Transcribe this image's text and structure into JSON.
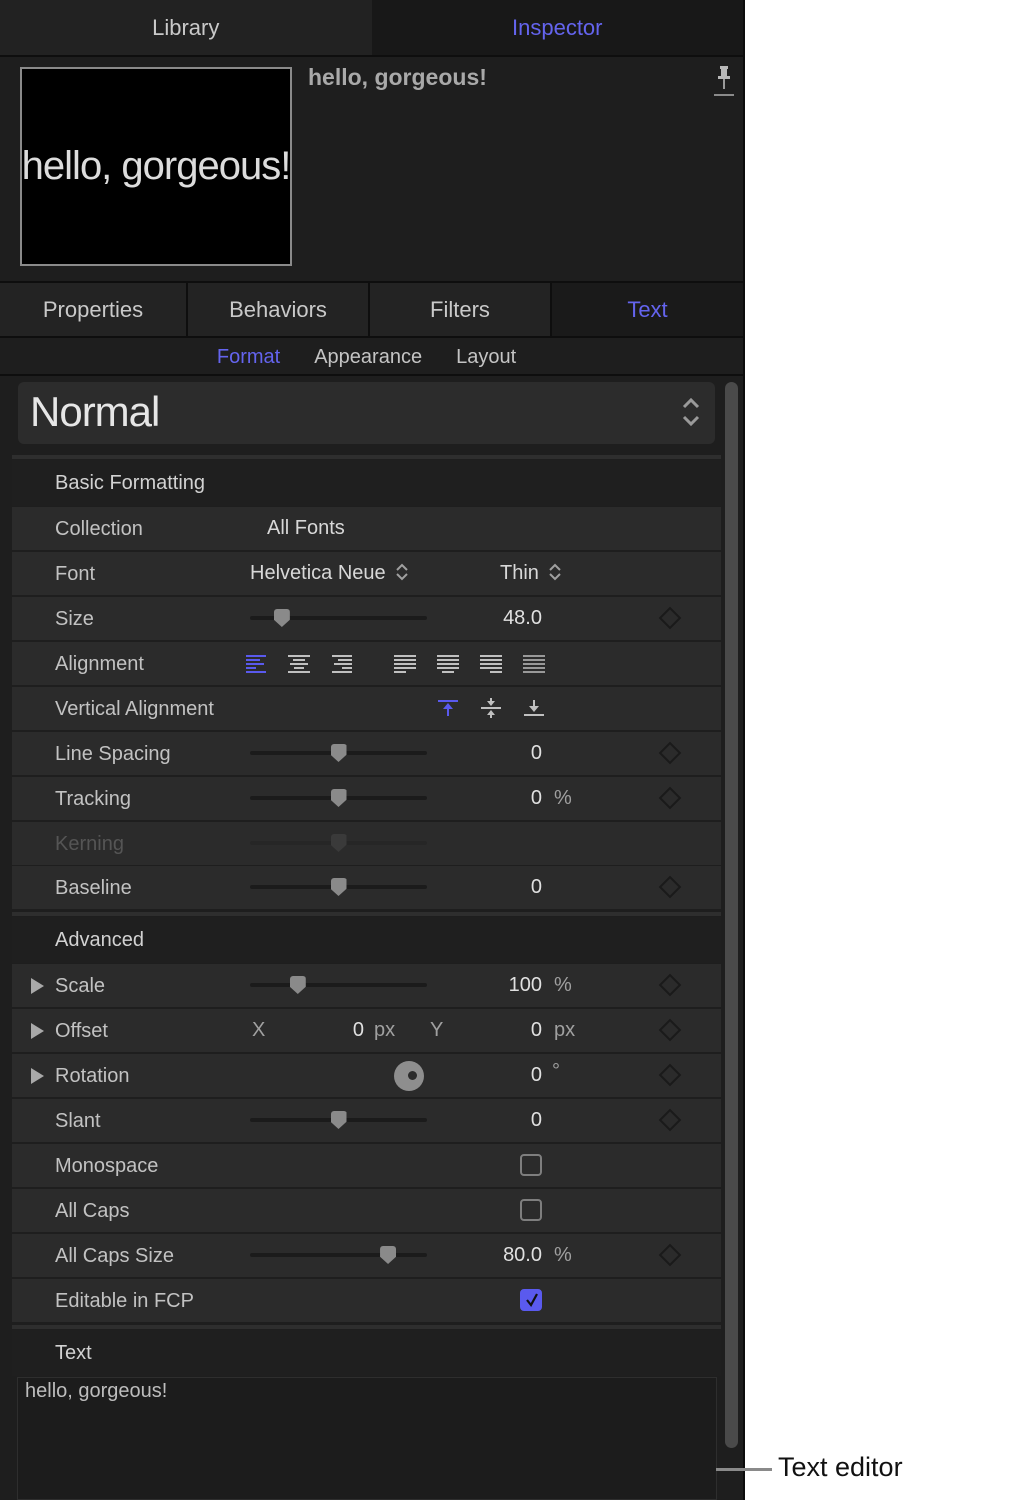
{
  "top_tabs": [
    {
      "label": "Library",
      "active": false
    },
    {
      "label": "Inspector",
      "active": true
    }
  ],
  "header": {
    "preview_text": "hello, gorgeous!",
    "object_name": "hello, gorgeous!",
    "pin_icon": "pushpin-icon"
  },
  "sub_tabs": [
    {
      "label": "Properties",
      "active": false
    },
    {
      "label": "Behaviors",
      "active": false
    },
    {
      "label": "Filters",
      "active": false
    },
    {
      "label": "Text",
      "active": true
    }
  ],
  "pane_tabs": [
    {
      "label": "Format",
      "active": true
    },
    {
      "label": "Appearance",
      "active": false
    },
    {
      "label": "Layout",
      "active": false
    }
  ],
  "preset": {
    "value": "Normal"
  },
  "basic_formatting": {
    "title": "Basic Formatting",
    "collection": {
      "label": "Collection",
      "value": "All Fonts"
    },
    "font": {
      "label": "Font",
      "family": "Helvetica Neue",
      "style": "Thin"
    },
    "size": {
      "label": "Size",
      "value": "48.0",
      "slider_fraction": 0.18
    },
    "alignment": {
      "label": "Alignment",
      "options": [
        "align-left",
        "align-center",
        "align-right",
        "justify-left",
        "justify-center",
        "justify-right",
        "justify-full"
      ],
      "selected": "align-left"
    },
    "vertical_alignment": {
      "label": "Vertical Alignment",
      "options": [
        "top",
        "middle",
        "bottom"
      ],
      "selected": "top"
    },
    "line_spacing": {
      "label": "Line Spacing",
      "value": "0",
      "slider_fraction": 0.5
    },
    "tracking": {
      "label": "Tracking",
      "value": "0",
      "unit": "%",
      "slider_fraction": 0.5
    },
    "kerning": {
      "label": "Kerning",
      "disabled": true,
      "slider_fraction": 0.5
    },
    "baseline": {
      "label": "Baseline",
      "value": "0",
      "slider_fraction": 0.5
    }
  },
  "advanced": {
    "title": "Advanced",
    "scale": {
      "label": "Scale",
      "value": "100",
      "unit": "%",
      "slider_fraction": 0.27
    },
    "offset": {
      "label": "Offset",
      "x_label": "X",
      "x_value": "0",
      "x_unit": "px",
      "y_label": "Y",
      "y_value": "0",
      "y_unit": "px"
    },
    "rotation": {
      "label": "Rotation",
      "value": "0",
      "unit": "°"
    },
    "slant": {
      "label": "Slant",
      "value": "0",
      "slider_fraction": 0.5
    },
    "monospace": {
      "label": "Monospace",
      "checked": false
    },
    "all_caps": {
      "label": "All Caps",
      "checked": false
    },
    "all_caps_size": {
      "label": "All Caps Size",
      "value": "80.0",
      "unit": "%",
      "slider_fraction": 0.78
    },
    "editable_in_fcp": {
      "label": "Editable in FCP",
      "checked": true
    }
  },
  "text_section": {
    "title": "Text",
    "value": "hello, gorgeous!"
  },
  "callout": {
    "label": "Text editor"
  },
  "colors": {
    "accent": "#6464ee",
    "panel_bg": "#1e1e1e",
    "row_bg": "#2b2b2b"
  }
}
